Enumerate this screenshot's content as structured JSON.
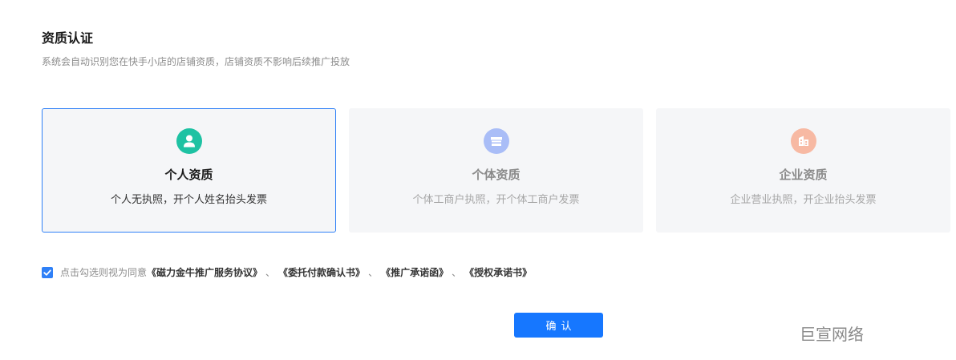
{
  "header": {
    "title": "资质认证",
    "subtitle": "系统会自动识别您在快手小店的店铺资质，店铺资质不影响后续推广投放"
  },
  "cards": [
    {
      "name": "个人资质",
      "desc": "个人无执照，开个人姓名抬头发票",
      "icon": "user-icon",
      "color": "#1ec2a3",
      "state": "selected"
    },
    {
      "name": "个体资质",
      "desc": "个体工商户执照，开个体工商户发票",
      "icon": "shop-icon",
      "color": "#a9bdf7",
      "state": "disabled"
    },
    {
      "name": "企业资质",
      "desc": "企业营业执照，开企业抬头发票",
      "icon": "building-icon",
      "color": "#f7b9a3",
      "state": "disabled"
    }
  ],
  "agreement": {
    "checked": true,
    "prefix": "点击勾选则视为同意",
    "links": [
      "《磁力金牛推广服务协议》",
      "《委托付款确认书》",
      "《推广承诺函》",
      "《授权承诺书》"
    ],
    "separator": "、"
  },
  "confirm_button": {
    "label": "确认"
  },
  "watermark": "巨宣网络",
  "colors": {
    "accent": "#1677ff",
    "selected_border": "#2f80f7",
    "card_bg": "#f5f6f8"
  }
}
